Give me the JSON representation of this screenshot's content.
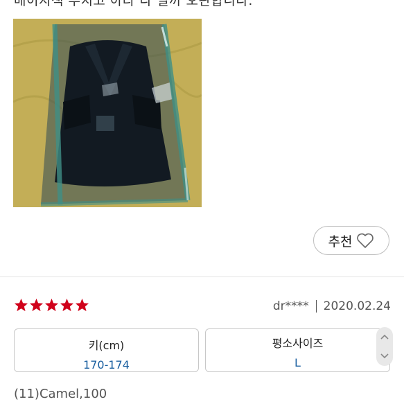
{
  "review": {
    "cut_text": "배이지색 부치고 아라 다 일까 오판합니다.",
    "recommend_label": "추천",
    "rating": 5,
    "author": "dr****",
    "date": "2020.02.24",
    "height": {
      "label": "키(cm)",
      "value": "170-174"
    },
    "usual_size": {
      "label": "평소사이즈",
      "value": "L"
    },
    "option": "(11)Camel,100"
  },
  "icons": {
    "recommend": "heart-outline-icon",
    "star": "star-icon",
    "scroll_up": "chevron-up-icon",
    "scroll_down": "chevron-down-icon"
  },
  "colors": {
    "star": "#d0021b",
    "value_text": "#1a5fa0"
  }
}
